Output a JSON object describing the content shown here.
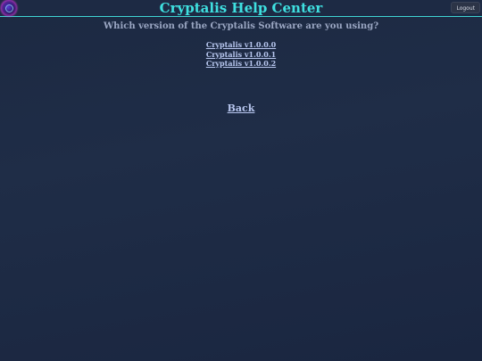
{
  "header": {
    "logo_icon": "cryptalis-orb-logo-icon",
    "title": "Cryptalis Help Center",
    "logout_label": "Logout"
  },
  "main": {
    "question": "Which version of the Cryptalis Software are you using?",
    "versions": [
      {
        "label": "Cryptalis v1.0.0.0"
      },
      {
        "label": "Cryptalis v1.0.0.1"
      },
      {
        "label": "Cryptalis v1.0.0.2"
      }
    ],
    "back_label": "Back"
  },
  "colors": {
    "background": "#1f2d47",
    "title": "#3fe0e0",
    "link": "#b7c6ee",
    "question": "#9aa6c2"
  }
}
